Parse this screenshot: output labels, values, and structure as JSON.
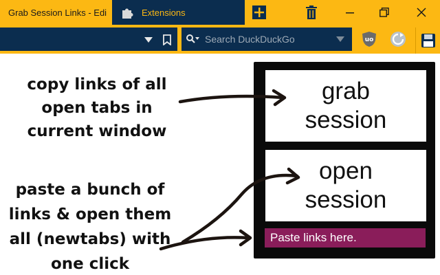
{
  "browser": {
    "tabs": [
      {
        "title": "Grab Session Links - Edi",
        "active": false
      },
      {
        "title": "Extensions",
        "active": true
      }
    ],
    "search": {
      "placeholder": "Search DuckDuckGo"
    },
    "colors": {
      "chrome": "#fcb813",
      "dark": "#0b2d4f",
      "accent": "#fcb813"
    },
    "icons": [
      "puzzle-icon",
      "new-tab-icon",
      "trash-icon",
      "minimize-icon",
      "maximize-icon",
      "close-icon",
      "chevron-down-icon",
      "bookmark-icon",
      "search-icon",
      "ublock-icon",
      "refresh-icon",
      "save-icon"
    ]
  },
  "annotations": {
    "grab": [
      "copy links of all",
      "open tabs in",
      "current window"
    ],
    "open": [
      "paste a bunch of",
      "links & open them",
      "all (newtabs) with",
      "one click"
    ]
  },
  "popup": {
    "grab_line1": "grab",
    "grab_line2": "session",
    "open_line1": "open",
    "open_line2": "session",
    "paste_placeholder": "Paste links here.",
    "colors": {
      "background": "#0a0a0a",
      "paste_field": "#8a1d5a"
    }
  }
}
